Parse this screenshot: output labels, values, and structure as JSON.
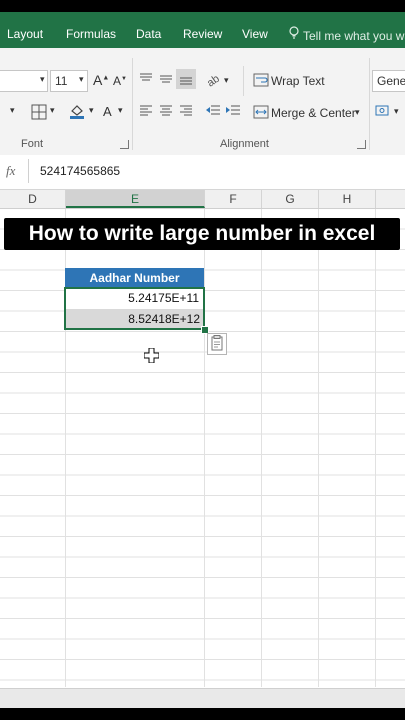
{
  "ribbon": {
    "tabs": [
      "Layout",
      "Formulas",
      "Data",
      "Review",
      "View"
    ],
    "tell_me": "Tell me what you wa",
    "font_size": "11",
    "wrap_text": "Wrap Text",
    "merge_center": "Merge & Center",
    "number_format": "Gene",
    "group_font": "Font",
    "group_alignment": "Alignment"
  },
  "formula_bar": {
    "fx": "fx",
    "value": "524174565865"
  },
  "columns": [
    "D",
    "E",
    "F",
    "G",
    "H"
  ],
  "selected_column": "E",
  "overlay_title": "How to write large number in excel",
  "table": {
    "header": "Aadhar Number",
    "rows": [
      "5.24175E+11",
      "8.52418E+12"
    ]
  },
  "colors": {
    "excel_green": "#217346",
    "header_blue": "#2e75b6"
  }
}
